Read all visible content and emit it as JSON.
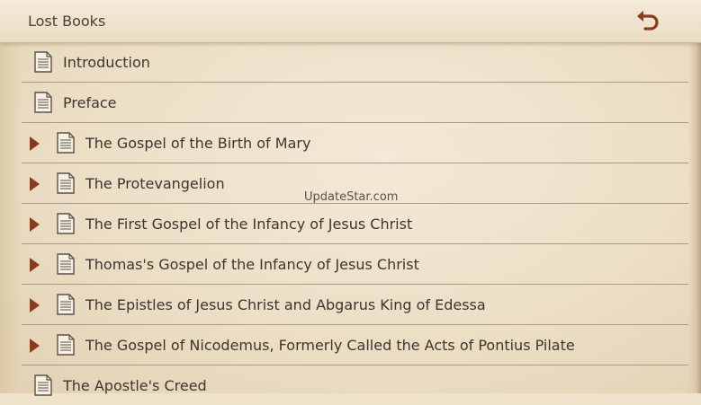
{
  "header": {
    "title": "Lost Books",
    "back_icon": "undo-arrow-icon"
  },
  "accent_color": "#8b3a1c",
  "items": [
    {
      "label": "Introduction",
      "expandable": false
    },
    {
      "label": "Preface",
      "expandable": false
    },
    {
      "label": "The Gospel of the Birth of Mary",
      "expandable": true
    },
    {
      "label": "The Protevangelion",
      "expandable": true
    },
    {
      "label": "The First Gospel of the Infancy of Jesus Christ",
      "expandable": true
    },
    {
      "label": "Thomas's Gospel of the Infancy of Jesus Christ",
      "expandable": true
    },
    {
      "label": "The Epistles of Jesus Christ and Abgarus King of Edessa",
      "expandable": true
    },
    {
      "label": "The Gospel of Nicodemus, Formerly Called the Acts of Pontius Pilate",
      "expandable": true
    },
    {
      "label": "The Apostle's Creed",
      "expandable": false
    }
  ],
  "watermark": "UpdateStar.com"
}
